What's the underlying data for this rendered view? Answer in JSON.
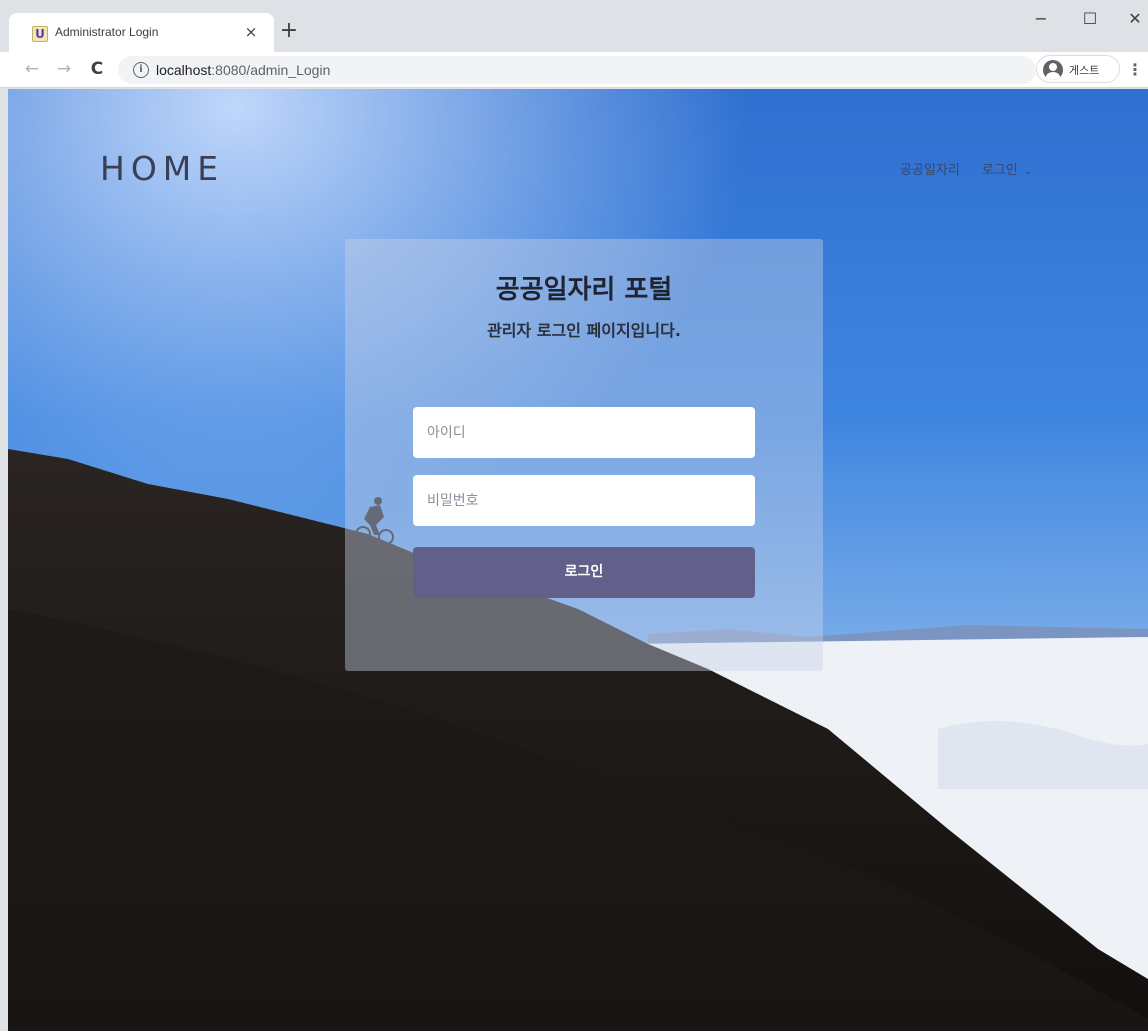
{
  "browser": {
    "tab_favicon": "U",
    "tab_title": "Administrator Login",
    "tab_close": "×",
    "new_tab": "+",
    "url_host": "localhost",
    "url_path": ":8080/admin_Login",
    "profile_label": "게스트",
    "window_minimize": "−",
    "window_maximize": "☐",
    "window_close": "✕"
  },
  "page": {
    "brand": "HOME",
    "nav": {
      "item1": "공공일자리",
      "item2": "로그인"
    },
    "login": {
      "title": "공공일자리 포털",
      "subtitle": "관리자 로그인 페이지입니다.",
      "id_placeholder": "아이디",
      "password_placeholder": "비밀번호",
      "button_label": "로그인"
    }
  },
  "colors": {
    "sky_top": "#2f6fd0",
    "sky_horizon": "#a9c8ee",
    "mountain": "#1a1614",
    "clouds": "#eef2f7",
    "button": "#62608a",
    "brand_text": "#3a3f58"
  }
}
